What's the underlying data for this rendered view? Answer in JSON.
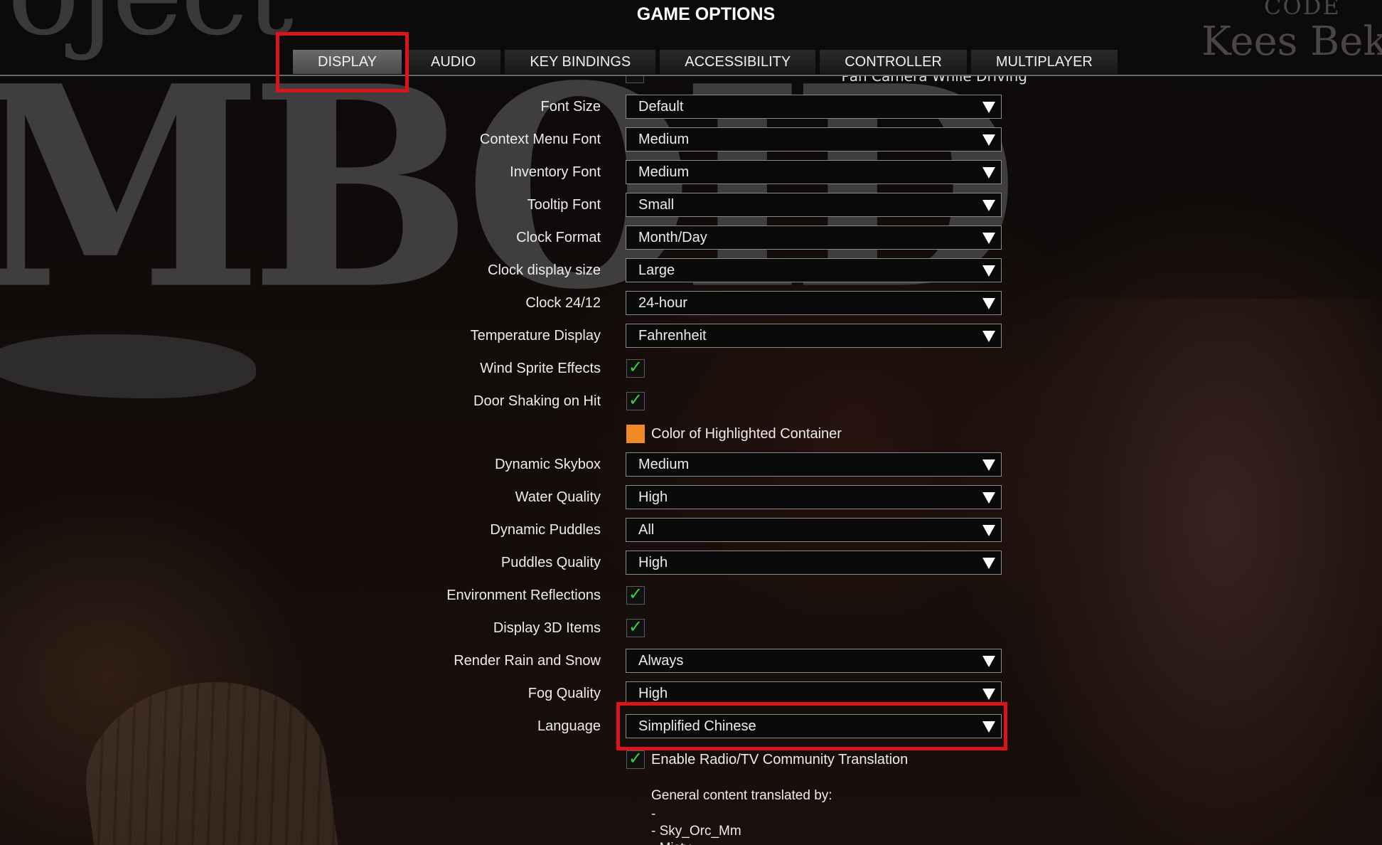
{
  "window": {
    "title": "GAME OPTIONS"
  },
  "background": {
    "logo_line1": "oject",
    "logo_line2": "MBOID",
    "credit_code": "CODE",
    "credit_name": "Kees Bekk"
  },
  "tabs": [
    {
      "label": "DISPLAY",
      "active": true
    },
    {
      "label": "AUDIO",
      "active": false
    },
    {
      "label": "KEY BINDINGS",
      "active": false
    },
    {
      "label": "ACCESSIBILITY",
      "active": false
    },
    {
      "label": "CONTROLLER",
      "active": false
    },
    {
      "label": "MULTIPLAYER",
      "active": false
    }
  ],
  "partial_row": {
    "label": "Pan Camera While Driving"
  },
  "settings": {
    "font_size": {
      "label": "Font Size",
      "value": "Default"
    },
    "context_menu_font": {
      "label": "Context Menu Font",
      "value": "Medium"
    },
    "inventory_font": {
      "label": "Inventory Font",
      "value": "Medium"
    },
    "tooltip_font": {
      "label": "Tooltip Font",
      "value": "Small"
    },
    "clock_format": {
      "label": "Clock Format",
      "value": "Month/Day"
    },
    "clock_display_size": {
      "label": "Clock display size",
      "value": "Large"
    },
    "clock_24_12": {
      "label": "Clock 24/12",
      "value": "24-hour"
    },
    "temperature_display": {
      "label": "Temperature Display",
      "value": "Fahrenheit"
    },
    "wind_sprite_effects": {
      "label": "Wind Sprite Effects",
      "checked": true
    },
    "door_shaking_on_hit": {
      "label": "Door Shaking on Hit",
      "checked": true
    },
    "highlighted_container_color": {
      "label": "Color of Highlighted Container",
      "color": "#f08a24"
    },
    "dynamic_skybox": {
      "label": "Dynamic Skybox",
      "value": "Medium"
    },
    "water_quality": {
      "label": "Water Quality",
      "value": "High"
    },
    "dynamic_puddles": {
      "label": "Dynamic Puddles",
      "value": "All"
    },
    "puddles_quality": {
      "label": "Puddles Quality",
      "value": "High"
    },
    "environment_reflections": {
      "label": "Environment Reflections",
      "checked": true
    },
    "display_3d_items": {
      "label": "Display 3D Items",
      "checked": true
    },
    "render_rain_and_snow": {
      "label": "Render Rain and Snow",
      "value": "Always"
    },
    "fog_quality": {
      "label": "Fog Quality",
      "value": "High"
    },
    "language": {
      "label": "Language",
      "value": "Simplified Chinese"
    },
    "radio_tv_translation": {
      "label": "Enable Radio/TV Community Translation",
      "checked": true
    }
  },
  "translation_credits": {
    "heading": "General content translated by:",
    "lines": [
      "-",
      "- Sky_Orc_Mm",
      "- Misty"
    ]
  },
  "colors": {
    "highlight_red": "#d9141b",
    "check_green": "#3ad13a",
    "active_tab": "#5a5a5a"
  },
  "icons": {
    "dropdown": "triangle-down-icon",
    "checkmark": "checkmark-icon"
  }
}
